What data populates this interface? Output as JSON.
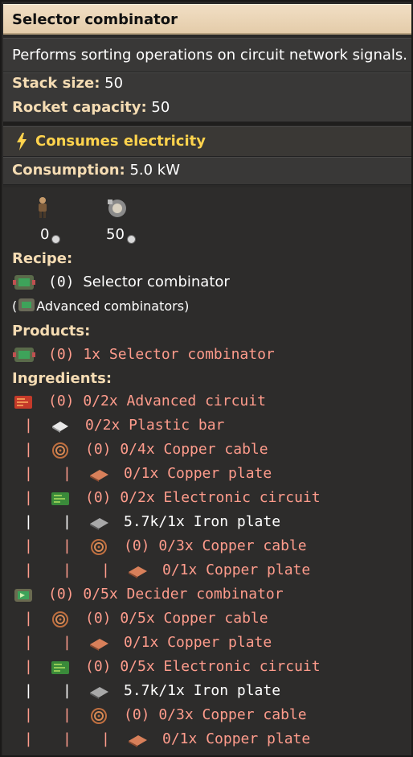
{
  "header": {
    "title": "Selector combinator"
  },
  "description": "Performs sorting operations on circuit network signals.",
  "stack_size_label": "Stack size:",
  "stack_size_value": "50",
  "rocket_capacity_label": "Rocket capacity:",
  "rocket_capacity_value": "50",
  "electricity": "Consumes electricity",
  "consumption_label": "Consumption:",
  "consumption_value": "5.0 kW",
  "stats": [
    {
      "value": "0"
    },
    {
      "value": "50"
    }
  ],
  "recipe_label": "Recipe:",
  "recipe_line": {
    "count": "(0)",
    "name": "Selector combinator"
  },
  "recipe_tech": {
    "open": "(",
    "name": "Advanced combinators",
    "close": ")"
  },
  "products_label": "Products:",
  "product_line": {
    "text": "(0) 1x Selector combinator"
  },
  "ingredients_label": "Ingredients:",
  "ingredients": [
    {
      "prefix": "",
      "text": "(0) 0/2x Advanced circuit",
      "color": "red",
      "icon": "advanced-circuit-icon"
    },
    {
      "prefix": "|",
      "text": "0/2x Plastic bar",
      "color": "red",
      "icon": "plastic-bar-icon"
    },
    {
      "prefix": "|",
      "text": "(0) 0/4x Copper cable",
      "color": "red",
      "icon": "copper-cable-icon"
    },
    {
      "prefix": "| |",
      "text": "0/1x Copper plate",
      "color": "red",
      "icon": "copper-plate-icon"
    },
    {
      "prefix": "|",
      "text": "(0) 0/2x Electronic circuit",
      "color": "red",
      "icon": "electronic-circuit-icon"
    },
    {
      "prefix": "| |",
      "text": "5.7k/1x Iron plate",
      "color": "white",
      "icon": "iron-plate-icon"
    },
    {
      "prefix": "| |",
      "text": "(0) 0/3x Copper cable",
      "color": "red",
      "icon": "copper-cable-icon"
    },
    {
      "prefix": "| | |",
      "text": "0/1x Copper plate",
      "color": "red",
      "icon": "copper-plate-icon"
    },
    {
      "prefix": "",
      "text": "(0) 0/5x Decider combinator",
      "color": "red",
      "icon": "decider-combinator-icon"
    },
    {
      "prefix": "|",
      "text": "(0) 0/5x Copper cable",
      "color": "red",
      "icon": "copper-cable-icon"
    },
    {
      "prefix": "| |",
      "text": "0/1x Copper plate",
      "color": "red",
      "icon": "copper-plate-icon"
    },
    {
      "prefix": "|",
      "text": "(0) 0/5x Electronic circuit",
      "color": "red",
      "icon": "electronic-circuit-icon"
    },
    {
      "prefix": "| |",
      "text": "5.7k/1x Iron plate",
      "color": "white",
      "icon": "iron-plate-icon"
    },
    {
      "prefix": "| |",
      "text": "(0) 0/3x Copper cable",
      "color": "red",
      "icon": "copper-cable-icon"
    },
    {
      "prefix": "| | |",
      "text": "0/1x Copper plate",
      "color": "red",
      "icon": "copper-plate-icon"
    }
  ]
}
